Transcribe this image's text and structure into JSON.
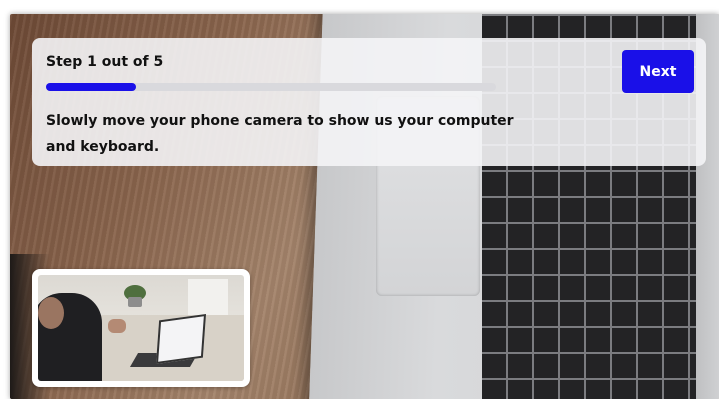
{
  "step": {
    "label": "Step 1 out of 5",
    "current": 1,
    "total": 5,
    "progress_fraction": 0.2
  },
  "instruction": "Slowly move your phone camera to show us your computer and keyboard.",
  "buttons": {
    "next_label": "Next"
  },
  "colors": {
    "accent": "#1a10e8",
    "card_background": "#f4f4f6",
    "text": "#111111"
  },
  "icons": {
    "selfview": "front-camera-preview"
  }
}
